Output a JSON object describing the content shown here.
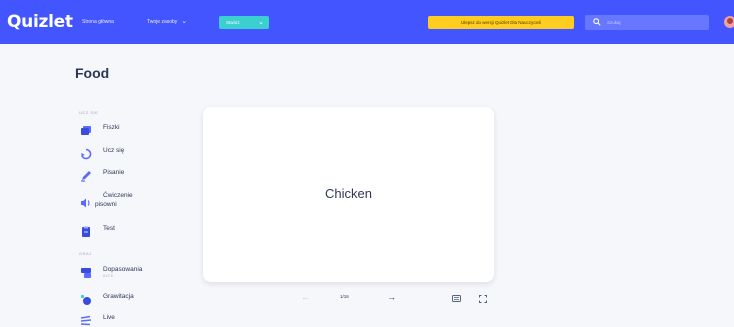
{
  "header": {
    "logo": "Quizlet",
    "nav": {
      "home": "Strona główna",
      "your_library": "Twoje zasoby"
    },
    "create_label": "Stwórz",
    "upgrade_label": "Ulepsz do wersji Quizlet Dla Nauczycieli",
    "search_placeholder": "Szukaj"
  },
  "set": {
    "title": "Food"
  },
  "sidebar": {
    "study_section": "UCZ SIĘ",
    "study_items": [
      {
        "label": "Fiszki",
        "icon": "flashcards-icon"
      },
      {
        "label": "Ucz się",
        "icon": "learn-icon"
      },
      {
        "label": "Pisanie",
        "icon": "write-icon"
      },
      {
        "label": "Ćwiczenie",
        "label2": "pisowni",
        "icon": "spell-icon"
      },
      {
        "label": "Test",
        "icon": "test-icon"
      }
    ],
    "games_section": "GRAJ",
    "game_items": [
      {
        "label": "Dopasowania",
        "sub": "0:17.5",
        "icon": "match-icon"
      },
      {
        "label": "Grawitacja",
        "icon": "gravity-icon"
      },
      {
        "label": "Live",
        "icon": "live-icon"
      }
    ]
  },
  "card": {
    "term": "Chicken"
  },
  "controls": {
    "counter": "1/16"
  },
  "colors": {
    "brand": "#4255ff",
    "create": "#3ccfcf",
    "upgrade": "#ffcd1f"
  }
}
